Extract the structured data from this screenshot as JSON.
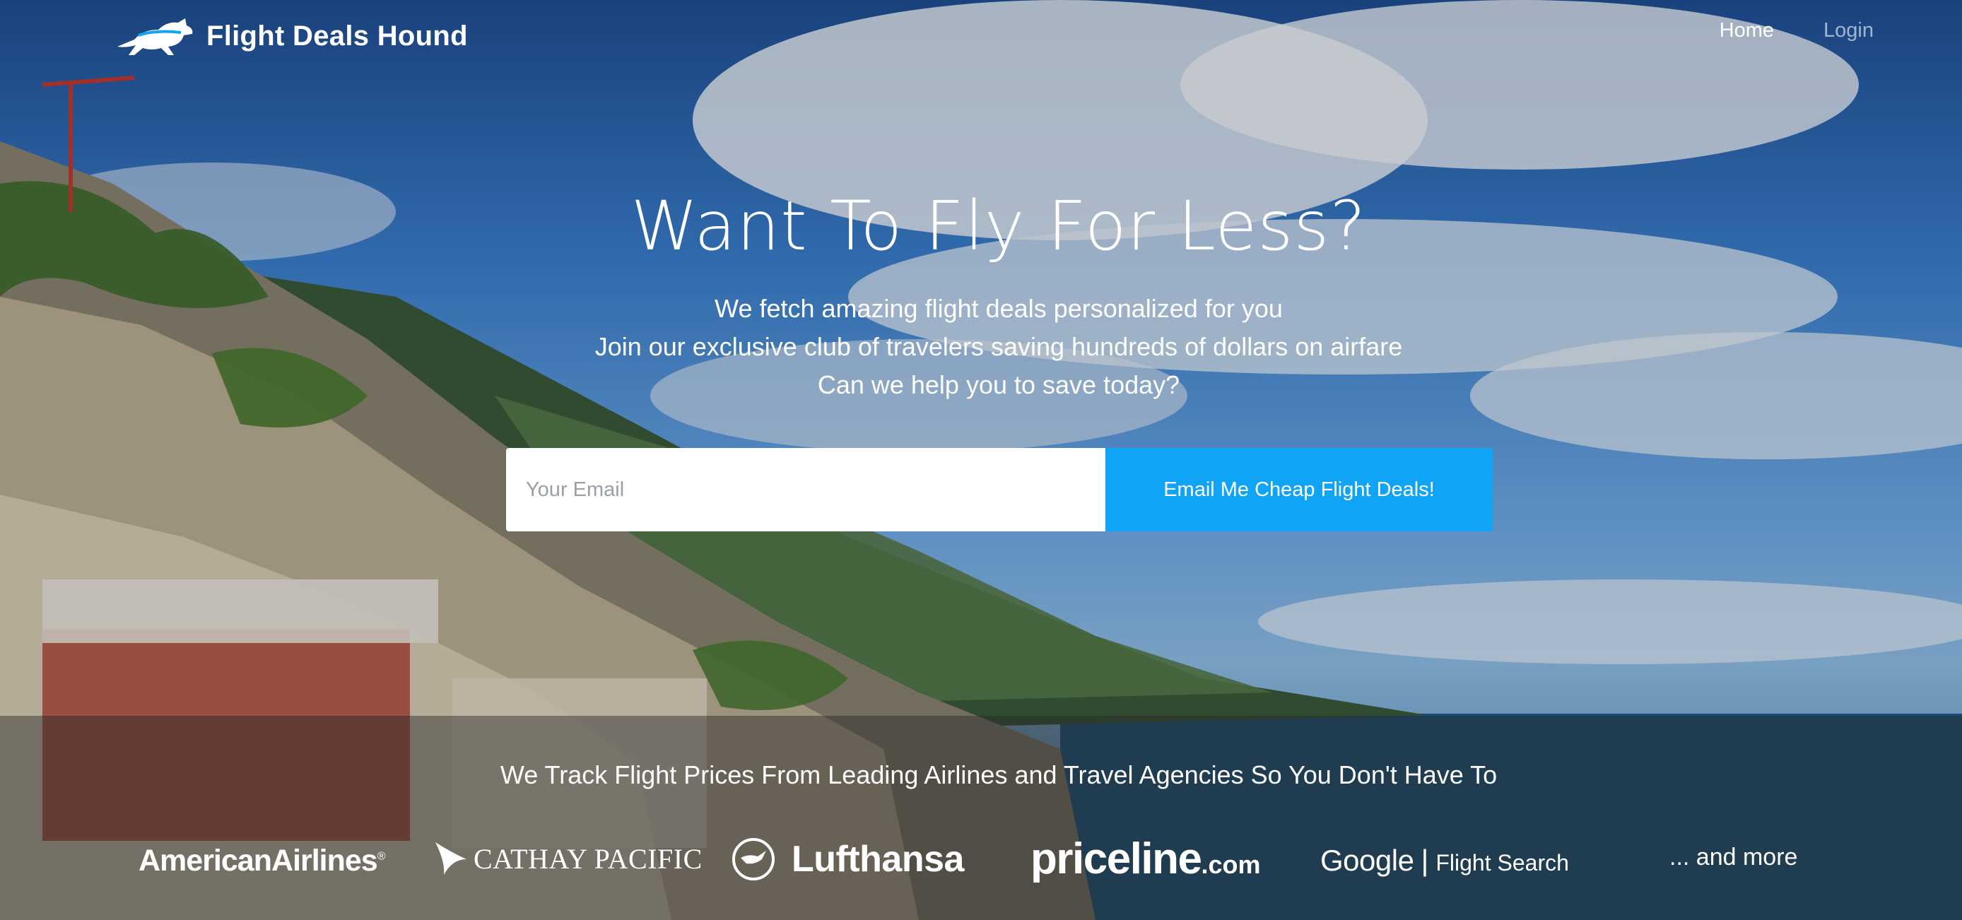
{
  "brand": {
    "name": "Flight Deals Hound",
    "logo_icon": "hound-dog-icon"
  },
  "nav": {
    "home": "Home",
    "login": "Login"
  },
  "hero": {
    "headline": "Want To Fly For Less?",
    "lines": [
      "We fetch amazing flight deals personalized for you",
      "Join our exclusive club of travelers saving hundreds of dollars on airfare",
      "Can we help you to save today?"
    ]
  },
  "signup": {
    "email_placeholder": "Your Email",
    "email_value": "",
    "submit_label": "Email Me Cheap Flight Deals!"
  },
  "partners": {
    "tagline": "We Track Flight Prices From Leading Airlines and Travel Agencies So You Don't Have To",
    "american_airlines": "AmericanAirlines",
    "american_airlines_mark": "®",
    "cathay_pacific": "CATHAY PACIFIC",
    "lufthansa": "Lufthansa",
    "priceline_main": "priceline",
    "priceline_suffix": ".com",
    "google_word": "Google",
    "google_separator": "|",
    "google_product": "Flight Search",
    "more": "... and more"
  },
  "colors": {
    "accent_button": "#0fa4f5",
    "band": "rgba(40,40,40,0.45)"
  }
}
